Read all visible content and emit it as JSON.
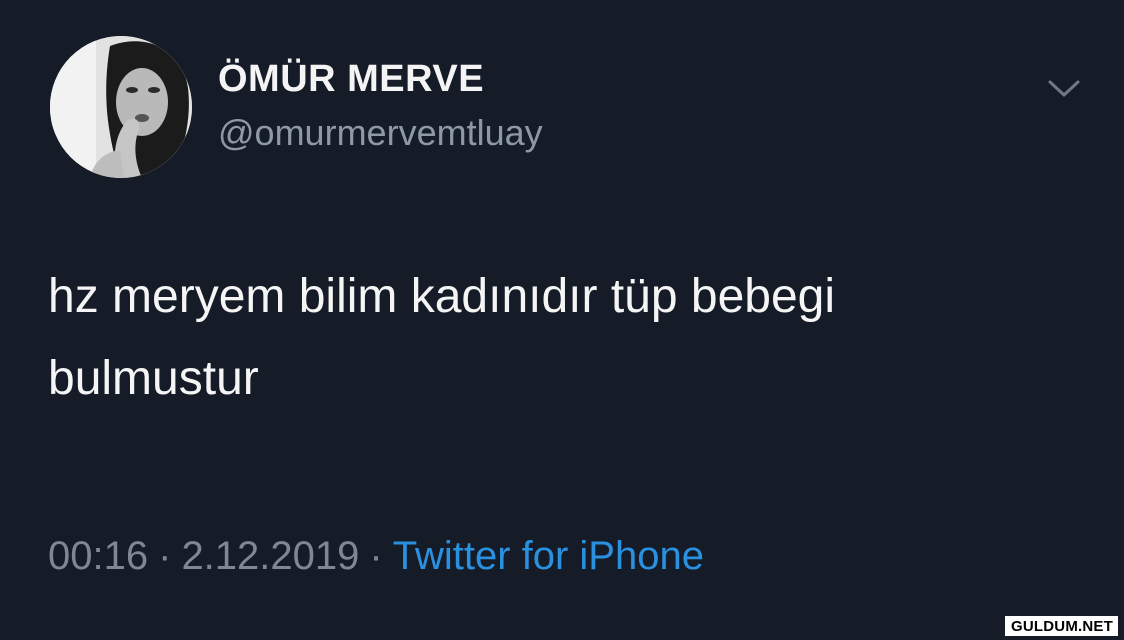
{
  "tweet": {
    "display_name": "ÖMÜR MERVE",
    "handle": "@omurmervemtluay",
    "text_line1": "hz meryem bilim kadınıdır tüp bebegi",
    "text_line2": "bulmustur",
    "time": "00:16",
    "date": "2.12.2019",
    "separator": "·",
    "source": "Twitter for iPhone",
    "menu_icon": "chevron-down-icon"
  },
  "watermark": "GULDUM.NET",
  "colors": {
    "background": "#151c28",
    "text": "#f5f5f5",
    "muted": "#8e99a6",
    "link": "#2a90e0"
  }
}
